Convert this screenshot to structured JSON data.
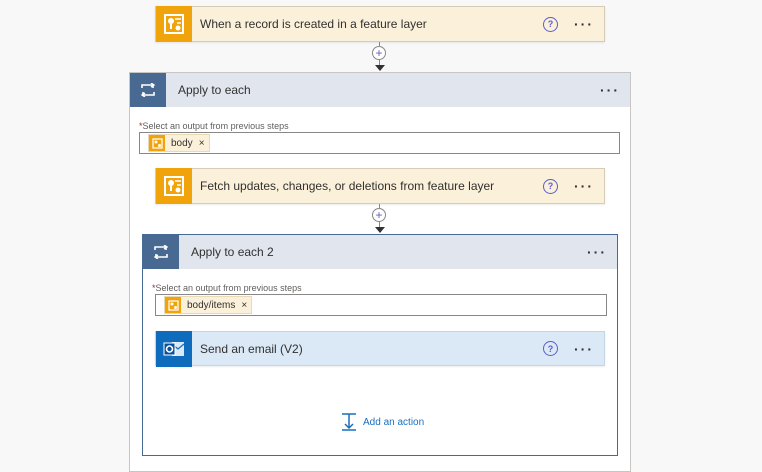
{
  "trigger": {
    "title": "When a record is created in a feature layer",
    "help": "?",
    "more": "···"
  },
  "connector1": {
    "plus": "+"
  },
  "apply_each": {
    "title": "Apply to each",
    "more": "···",
    "field_label": "Select an output from previous steps",
    "token": "body",
    "token_remove": "×"
  },
  "fetch": {
    "title": "Fetch updates, changes, or deletions from feature layer",
    "help": "?",
    "more": "···"
  },
  "connector2": {
    "plus": "+"
  },
  "apply_each_2": {
    "title": "Apply to each 2",
    "more": "···",
    "field_label": "Select an output from previous steps",
    "token": "body/items",
    "token_remove": "×"
  },
  "send_email": {
    "title": "Send an email (V2)",
    "help": "?",
    "more": "···"
  },
  "add_action": {
    "label": "Add an action"
  }
}
